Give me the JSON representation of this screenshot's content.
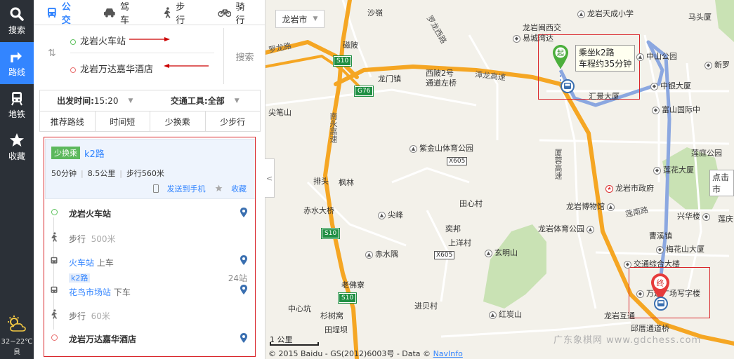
{
  "rail": {
    "items": [
      {
        "label": "搜索",
        "icon": "search-icon",
        "active": false
      },
      {
        "label": "路线",
        "icon": "route-icon",
        "active": true
      },
      {
        "label": "地铁",
        "icon": "subway-icon",
        "active": false
      },
      {
        "label": "收藏",
        "icon": "star-icon",
        "active": false
      }
    ],
    "weather": {
      "temp": "32~22℃",
      "desc": "良",
      "icon": "weather-sun-cloud-icon"
    }
  },
  "modes": [
    {
      "label": "公交",
      "icon": "bus-icon",
      "active": true
    },
    {
      "label": "驾车",
      "icon": "car-icon",
      "active": false
    },
    {
      "label": "步行",
      "icon": "walk-icon",
      "active": false
    },
    {
      "label": "骑行",
      "icon": "bike-icon",
      "active": false
    }
  ],
  "route": {
    "start": "龙岩火车站",
    "end": "龙岩万达嘉华酒店",
    "search_label": "搜索"
  },
  "options": {
    "depart_label": "出发时间:",
    "depart_value": "15:20",
    "tool_label": "交通工具:",
    "tool_value": "全部",
    "tabs": [
      "推荐路线",
      "时间短",
      "少换乘",
      "少步行"
    ]
  },
  "result": {
    "badge": "少换乘",
    "line": "k2路",
    "duration": "50分钟",
    "distance": "8.5公里",
    "walk": "步行560米",
    "send_phone": "发送到手机",
    "favorite": "收藏"
  },
  "steps": {
    "start": "龙岩火车站",
    "walk1_label": "步行",
    "walk1_dist": "500米",
    "board_stop": "火车站",
    "board_action": "上车",
    "line_chip": "k2路",
    "stops": "24站",
    "alight_stop": "花鸟市场站",
    "alight_action": "下车",
    "walk2_label": "步行",
    "walk2_dist": "60米",
    "end": "龙岩万达嘉华酒店"
  },
  "map": {
    "city": "龙岩市",
    "tooltip_line1": "乘坐k2路",
    "tooltip_line2": "车程约35分钟",
    "start_marker": "起",
    "end_marker": "终",
    "scale": "1 公里",
    "copyright": "© 2015 Baidu - GS(2012)6003号 - Data ©",
    "navinfo": "NavInfo",
    "watermark": "广东象棋网 www.gdchess.com",
    "click_more": "点击市",
    "labels": {
      "shaxu": "沙嶺",
      "luolong": "罗龙西路",
      "longyan_tianyang": "龙岩天成小学",
      "majia": "马头厦",
      "luolongroad": "罗龙路",
      "s10a": "S10",
      "tanlin": "磁陂",
      "longyan_xingxi": "龙岩闽西交",
      "yiwan": "易城湾达",
      "zhongshan": "中山公园",
      "xinluo": "新罗",
      "longmen": "龙门镇",
      "xipo": "西陂2号",
      "tongdao": "通道左桥",
      "zhanglong": "漳龙高速",
      "g76": "G76",
      "huijing": "汇景大厦",
      "zhongyin": "中银大厦",
      "fushan": "富山国际中",
      "jianbiao": "尖笔山",
      "nanyong": "南永高速",
      "zijin": "紫金山体育公园",
      "x605a": "X605",
      "xiayong": "厦蓉高速",
      "lianting": "莲庭公园",
      "lianhua": "莲花大厦",
      "paitou": "排头",
      "fenglin": "枫林",
      "gov": "龙岩市政府",
      "museum": "龙岩博物馆",
      "chishui": "赤水大桥",
      "jianfeng": "尖峰",
      "tianxin": "田心村",
      "lianan": "莲南路",
      "xingnan": "兴华楼",
      "tiyu": "龙岩体育公园",
      "caoxi": "曹溪镇",
      "lanqin": "莲庆",
      "s10b": "S10",
      "qibang": "奕邦",
      "chishuixi": "赤水隅",
      "shangyang": "上洋村",
      "x605b": "X605",
      "xuanming": "玄明山",
      "meihua": "梅花山大厦",
      "jiaotong": "交通综合大楼",
      "laofusai": "老佛寮",
      "wanda": "万达广场写字楼",
      "s10c": "S10",
      "jinyaocun": "进贝村",
      "zhongxin": "中心坑",
      "shanquan": "杉树窝",
      "hongtan": "红炭山",
      "longyan_tong": "龙岩互通",
      "tiantou": "田埕坝",
      "dianqiao": "邱厝通道桥",
      "nanyong2": "南永"
    }
  }
}
